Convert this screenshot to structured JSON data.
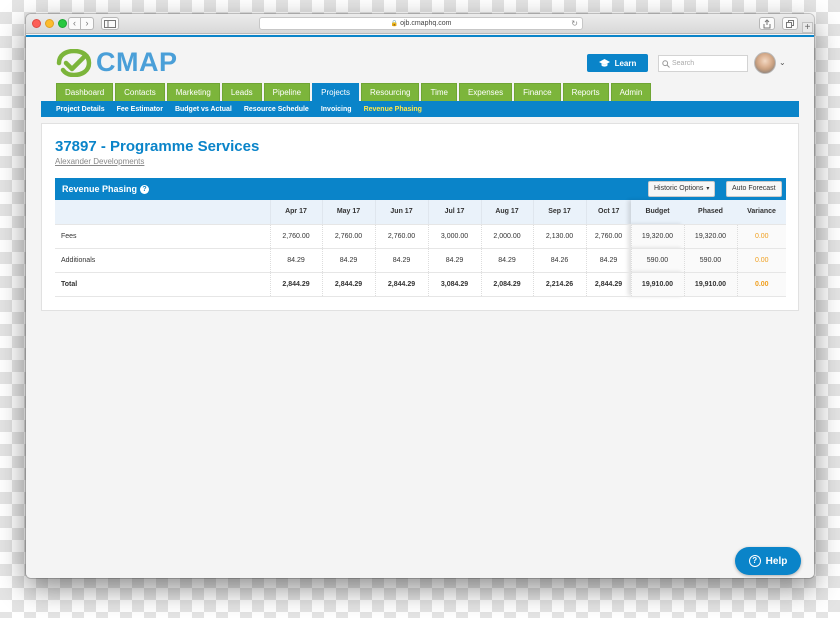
{
  "browser": {
    "url": "ojb.cmaphq.com",
    "back": "‹",
    "forward": "›",
    "reload": "↻",
    "new_tab": "+"
  },
  "brand": {
    "name": "CMAP",
    "accent": "#0a84c9",
    "nav_green": "#7cb53b",
    "variance_orange": "#f0a020"
  },
  "header": {
    "learn_label": "Learn",
    "search_placeholder": "Search",
    "avatar_caret": "⌄"
  },
  "main_nav": {
    "tabs": [
      {
        "label": "Dashboard"
      },
      {
        "label": "Contacts"
      },
      {
        "label": "Marketing"
      },
      {
        "label": "Leads"
      },
      {
        "label": "Pipeline"
      },
      {
        "label": "Projects"
      },
      {
        "label": "Resourcing"
      },
      {
        "label": "Time"
      },
      {
        "label": "Expenses"
      },
      {
        "label": "Finance"
      },
      {
        "label": "Reports"
      },
      {
        "label": "Admin"
      }
    ],
    "active": "Projects"
  },
  "sub_nav": {
    "items": [
      {
        "label": "Project Details"
      },
      {
        "label": "Fee Estimator"
      },
      {
        "label": "Budget vs Actual"
      },
      {
        "label": "Resource Schedule"
      },
      {
        "label": "Invoicing"
      },
      {
        "label": "Revenue Phasing"
      }
    ],
    "active": "Revenue Phasing"
  },
  "project": {
    "title": "37897 - Programme Services",
    "client": "Alexander Developments"
  },
  "revenue_phasing": {
    "title": "Revenue Phasing",
    "info": "?",
    "historic_options_label": "Historic Options",
    "historic_caret": "▾",
    "auto_forecast_label": "Auto Forecast",
    "columns": [
      "",
      "Apr 17",
      "May 17",
      "Jun 17",
      "Jul 17",
      "Aug 17",
      "Sep 17",
      "Oct 17",
      "Budget",
      "Phased",
      "Variance"
    ],
    "rows": [
      {
        "label": "Fees",
        "values": [
          "2,760.00",
          "2,760.00",
          "2,760.00",
          "3,000.00",
          "2,000.00",
          "2,130.00",
          "2,760.00"
        ],
        "budget": "19,320.00",
        "phased": "19,320.00",
        "variance": "0.00"
      },
      {
        "label": "Additionals",
        "values": [
          "84.29",
          "84.29",
          "84.29",
          "84.29",
          "84.29",
          "84.26",
          "84.29"
        ],
        "budget": "590.00",
        "phased": "590.00",
        "variance": "0.00"
      },
      {
        "label": "Total",
        "values": [
          "2,844.29",
          "2,844.29",
          "2,844.29",
          "3,084.29",
          "2,084.29",
          "2,214.26",
          "2,844.29"
        ],
        "budget": "19,910.00",
        "phased": "19,910.00",
        "variance": "0.00"
      }
    ]
  },
  "help": {
    "label": "Help",
    "icon": "?"
  }
}
